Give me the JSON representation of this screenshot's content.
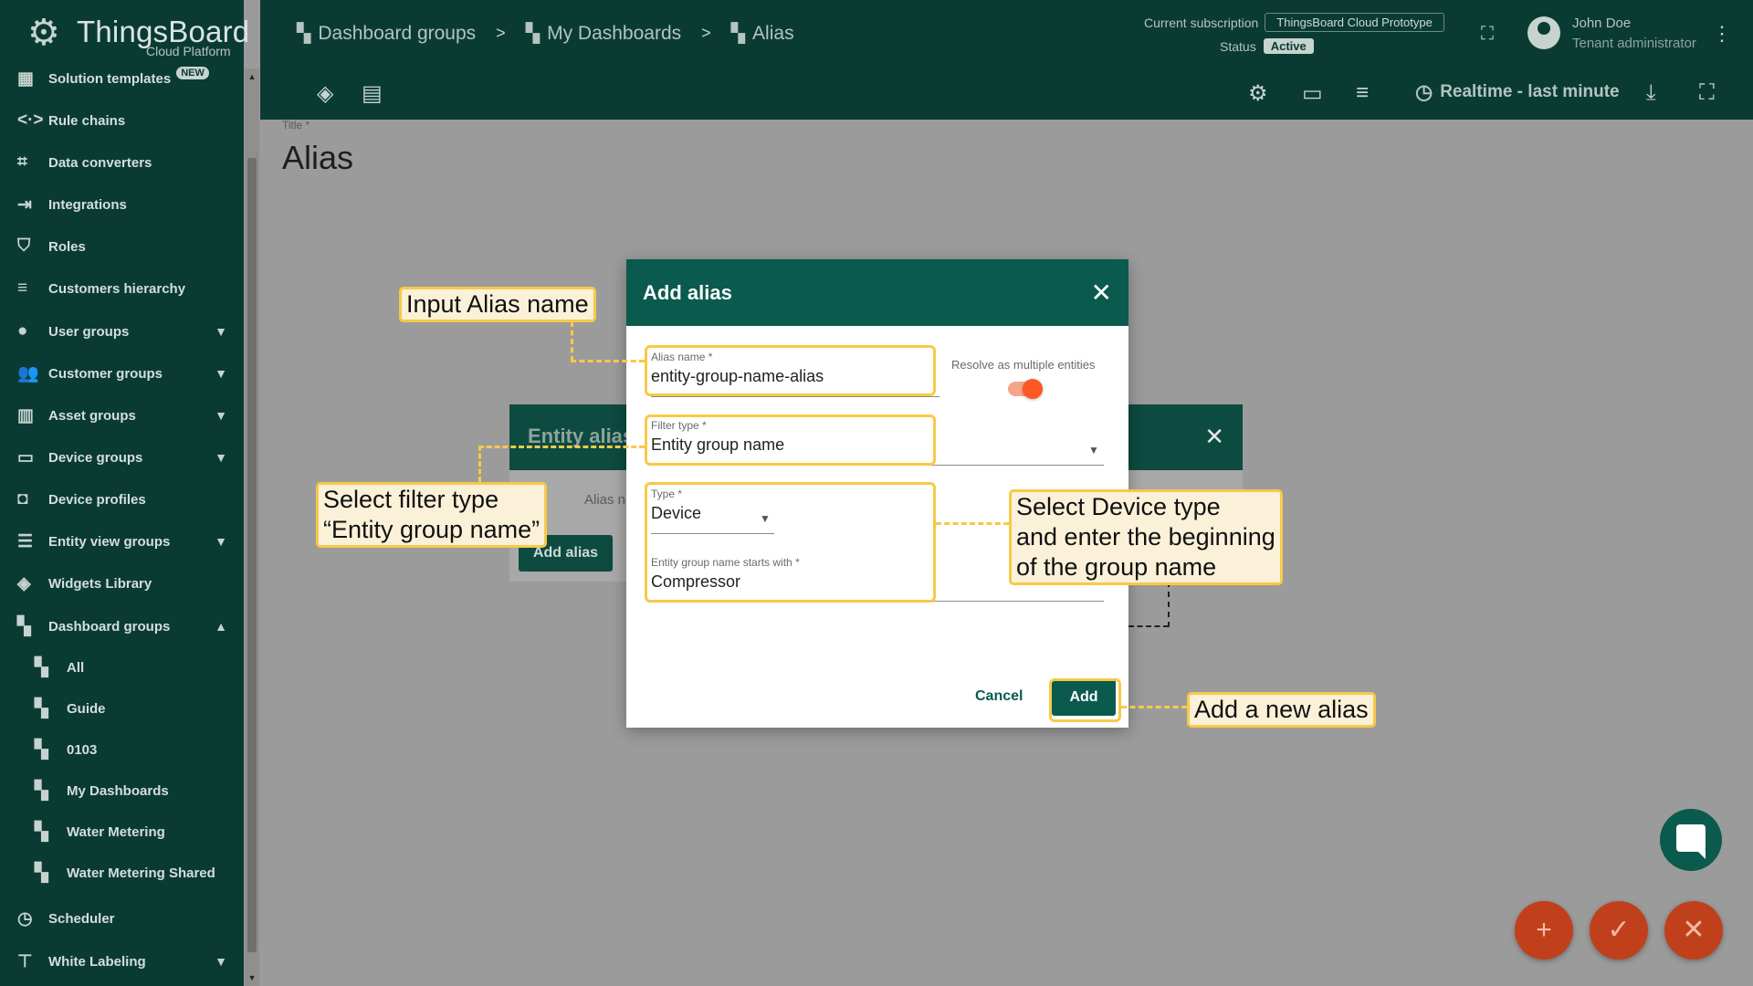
{
  "brand": {
    "name": "ThingsBoard",
    "subtitle": "Cloud Platform"
  },
  "sidebar": {
    "items": [
      {
        "label": "Solution templates",
        "badge": "NEW",
        "icon": "apps-icon"
      },
      {
        "label": "Rule chains",
        "icon": "code-arrows-icon"
      },
      {
        "label": "Data converters",
        "icon": "transform-icon"
      },
      {
        "label": "Integrations",
        "icon": "input-icon"
      },
      {
        "label": "Roles",
        "icon": "shield-icon"
      },
      {
        "label": "Customers hierarchy",
        "icon": "sort-lines-icon"
      },
      {
        "label": "User groups",
        "icon": "account-circle-icon"
      },
      {
        "label": "Customer groups",
        "icon": "people-icon"
      },
      {
        "label": "Asset groups",
        "icon": "domain-icon"
      },
      {
        "label": "Device groups",
        "icon": "devices-icon"
      },
      {
        "label": "Device profiles",
        "icon": "device-profile-icon"
      },
      {
        "label": "Entity view groups",
        "icon": "view-list-icon"
      },
      {
        "label": "Widgets Library",
        "icon": "widgets-icon"
      },
      {
        "label": "Dashboard groups",
        "icon": "dashboard-icon"
      },
      {
        "label": "All",
        "icon": "dashboard-icon"
      },
      {
        "label": "Guide",
        "icon": "dashboard-icon"
      },
      {
        "label": "0103",
        "icon": "dashboard-icon"
      },
      {
        "label": "My Dashboards",
        "icon": "dashboard-icon"
      },
      {
        "label": "Water Metering",
        "icon": "dashboard-icon"
      },
      {
        "label": "Water Metering Shared",
        "icon": "dashboard-icon"
      },
      {
        "label": "Scheduler",
        "icon": "clock-icon"
      },
      {
        "label": "White Labeling",
        "icon": "format-paint-icon"
      }
    ]
  },
  "header": {
    "breadcrumbs": [
      "Dashboard groups",
      "My Dashboards",
      "Alias"
    ],
    "subscription_label": "Current subscription",
    "subscription_value": "ThingsBoard Cloud Prototype",
    "status_label": "Status",
    "status_value": "Active",
    "user_name": "John Doe",
    "user_role": "Tenant administrator",
    "timewindow": "Realtime - last minute"
  },
  "content": {
    "title_label": "Title *",
    "title": "Alias"
  },
  "back_dialog": {
    "title": "Entity aliases",
    "column": "Alias name",
    "add_button": "Add alias"
  },
  "dialog": {
    "title": "Add alias",
    "alias_name_label": "Alias name *",
    "alias_name_value": "entity-group-name-alias",
    "resolve_multiple_label": "Resolve as multiple entities",
    "resolve_multiple": true,
    "filter_type_label": "Filter type *",
    "filter_type_value": "Entity group name",
    "type_label": "Type *",
    "type_value": "Device",
    "group_name_label": "Entity group name starts with *",
    "group_name_value": "Compressor",
    "cancel": "Cancel",
    "add": "Add"
  },
  "callouts": {
    "alias_name": "Input Alias name",
    "filter_type_line1": "Select filter type",
    "filter_type_line2": "“Entity group name”",
    "device_line1": "Select Device type",
    "device_line2": "and enter the beginning",
    "device_line3": "of the group name",
    "add_alias": "Add a new alias"
  },
  "colors": {
    "primary": "#0a3b33",
    "accent": "#ff5722",
    "highlight": "#f7c948",
    "callout_bg": "#fbf1d8"
  }
}
